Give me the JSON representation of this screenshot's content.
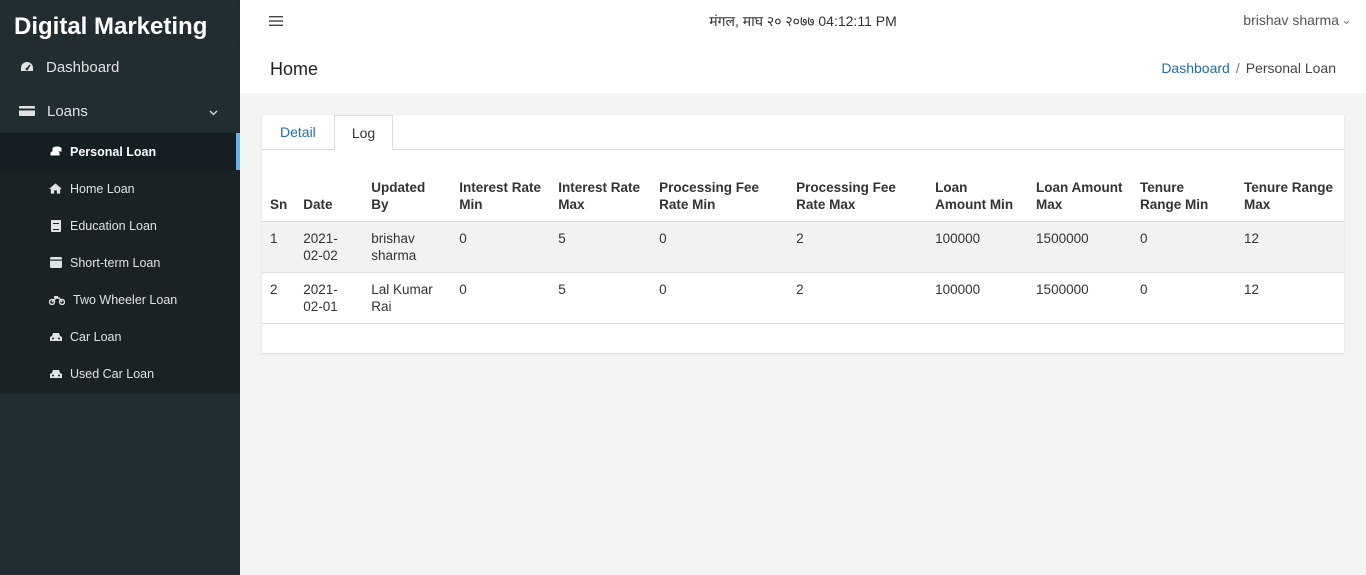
{
  "sidebar": {
    "brand": "Digital Marketing",
    "dashboard": {
      "label": "Dashboard",
      "icon": "dashboard-gauge-icon"
    },
    "loans": {
      "label": "Loans",
      "icon": "credit-card-icon"
    },
    "sub_items": [
      {
        "label": "Personal Loan",
        "icon": "coins-icon",
        "active": true
      },
      {
        "label": "Home Loan",
        "icon": "home-icon"
      },
      {
        "label": "Education Loan",
        "icon": "book-icon"
      },
      {
        "label": "Short-term Loan",
        "icon": "card-icon"
      },
      {
        "label": "Two Wheeler Loan",
        "icon": "motorcycle-icon"
      },
      {
        "label": "Car Loan",
        "icon": "car-icon"
      },
      {
        "label": "Used Car Loan",
        "icon": "car-icon"
      }
    ]
  },
  "header": {
    "datetime": "मंगल, माघ २० २०७७ 04:12:11 PM",
    "user": "brishav sharma"
  },
  "content_header": {
    "title": "Home",
    "breadcrumb": {
      "link": "Dashboard",
      "separator": "/",
      "current": "Personal Loan"
    }
  },
  "tabs": [
    {
      "label": "Detail",
      "active": false
    },
    {
      "label": "Log",
      "active": true
    }
  ],
  "table": {
    "columns": [
      "Sn",
      "Date",
      "Updated By",
      "Interest Rate Min",
      "Interest Rate Max",
      "Processing Fee Rate Min",
      "Processing Fee Rate Max",
      "Loan Amount Min",
      "Loan Amount Max",
      "Tenure Range Min",
      "Tenure Range Max"
    ],
    "rows": [
      [
        "1",
        "2021-02-02",
        "brishav sharma",
        "0",
        "5",
        "0",
        "2",
        "100000",
        "1500000",
        "0",
        "12"
      ],
      [
        "2",
        "2021-02-01",
        "Lal Kumar Rai",
        "0",
        "5",
        "0",
        "2",
        "100000",
        "1500000",
        "0",
        "12"
      ]
    ]
  },
  "colors": {
    "sidebar_bg": "#222d32",
    "submenu_bg": "#1a2226",
    "active_accent": "#5fb3e6",
    "link": "#1f6fa8"
  }
}
